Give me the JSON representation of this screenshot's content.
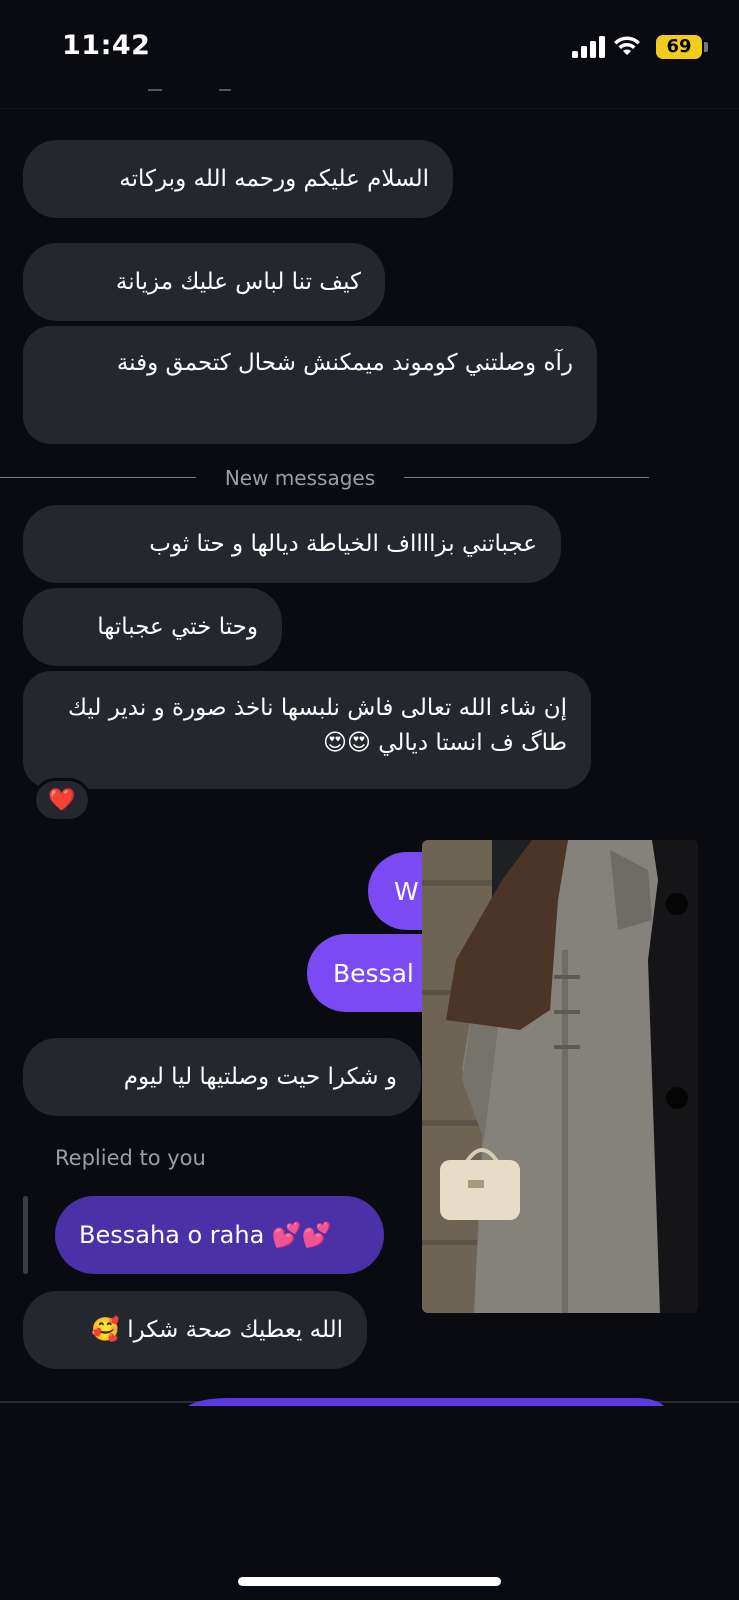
{
  "status_bar": {
    "time": "11:42",
    "battery": "69",
    "signal_icon": "cellular-signal-icon",
    "wifi_icon": "wifi-icon"
  },
  "divider": {
    "label": "New messages"
  },
  "messages_before": [
    {
      "text": "السلام عليكم ورحمه الله وبركاته"
    },
    {
      "text": "كيف تنا لباس عليك مزيانة"
    },
    {
      "text": "رآه وصلتني كوموند ميمكنش شحال كتحمق وفنة"
    }
  ],
  "messages_after": [
    {
      "text": "عجباتني بزااااف الخياطة ديالها و حتا ثوب"
    },
    {
      "text": "وحتا ختي عجباتها"
    },
    {
      "text": "إن شاء الله تعالى فاش نلبسها ناخذ صورة و ندير ليك طاگ ف انستا ديالي 😍😍"
    }
  ],
  "reaction": "❤️",
  "sent_messages": [
    {
      "text": "W"
    },
    {
      "text": "Bessal"
    }
  ],
  "received_thanks": {
    "text": "و شكرا حيت وصلتيها ليا ليوم"
  },
  "reply": {
    "label": "Replied to you",
    "quoted_text": "Bessaha o raha 💕💕"
  },
  "last_message": {
    "text": "الله يعطيك صحة شكرا 🥰"
  },
  "colors": {
    "background": "#0a0b10",
    "incoming_bubble": "#25272e",
    "outgoing_bubble": "#7a4bf4",
    "reply_bubble": "#4a31a8",
    "battery": "#f2cc1d"
  }
}
